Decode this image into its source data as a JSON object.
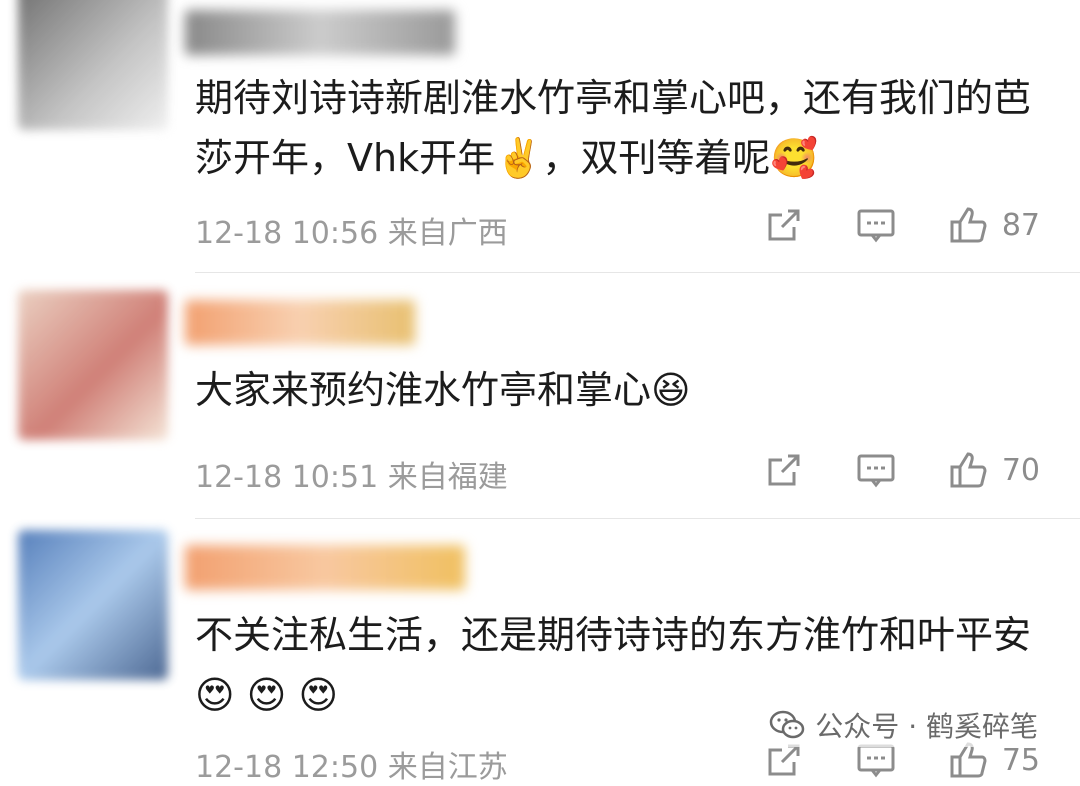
{
  "comments": [
    {
      "text": "期待刘诗诗新剧淮水竹亭和掌心吧，还有我们的芭莎开年，Vhk开年",
      "text_tail": "，双刊等着呢",
      "emoji_1": "✌️",
      "emoji_2": "🥰",
      "time": "12-18 10:56",
      "location": "来自广西",
      "likes": "87",
      "avatar_color": "#7a7a7a",
      "name_color": "#9a9a9a"
    },
    {
      "text": "大家来预约淮水竹亭和掌心",
      "emoji_1": "😆",
      "time": "12-18 10:51",
      "location": "来自福建",
      "likes": "70",
      "avatar_color": "#c98a7a",
      "name_color": "#f0a070"
    },
    {
      "text": "不关注私生活，还是期待诗诗的东方淮竹和叶平安",
      "emoji_1": "😍",
      "emoji_2": "😍",
      "emoji_3": "😍",
      "time": "12-18 12:50",
      "location": "来自江苏",
      "likes": "75",
      "avatar_color": "#5a8ec8",
      "name_color": "#f0a070"
    }
  ],
  "watermark": {
    "label": "公众号 · 鹤奚碎笔",
    "icon": "wechat-icon"
  },
  "actions": {
    "share_icon": "share-icon",
    "comment_icon": "comment-icon",
    "like_icon": "thumbs-up-icon"
  }
}
